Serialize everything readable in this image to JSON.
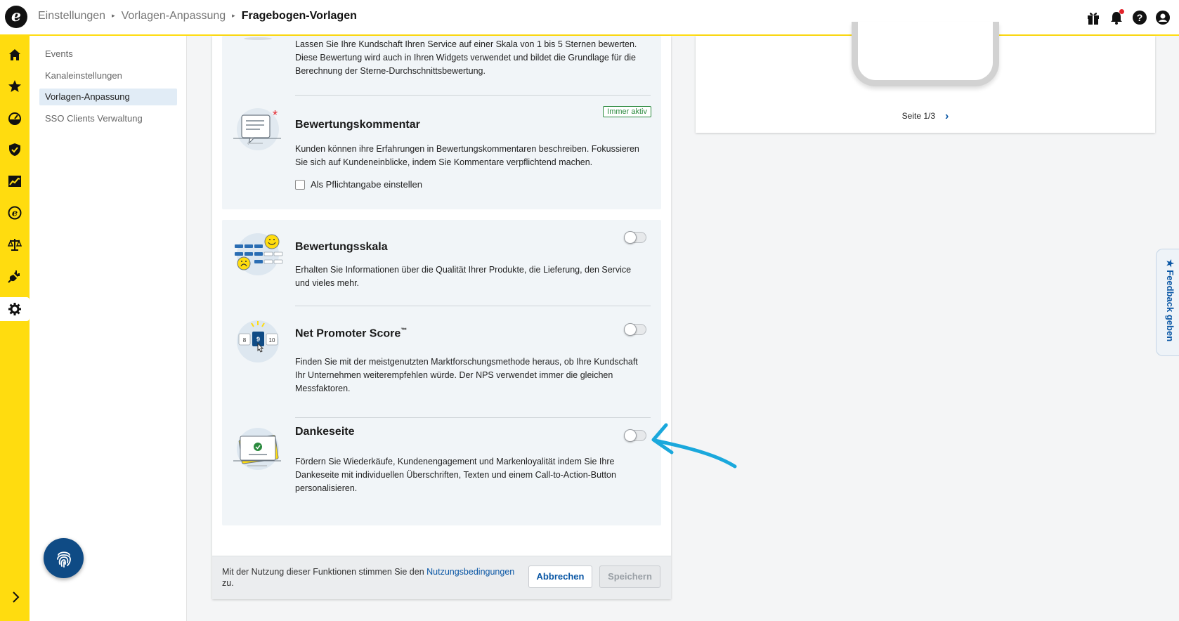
{
  "header": {
    "logo_text": "e",
    "breadcrumb": [
      "Einstellungen",
      "Vorlagen-Anpassung",
      "Fragebogen-Vorlagen"
    ],
    "separator": "▸",
    "icons": [
      "gift-icon",
      "bell-icon",
      "help-icon",
      "user-icon"
    ]
  },
  "rail": {
    "items": [
      "home-icon",
      "star-icon",
      "dashboard-icon",
      "shield-icon",
      "chart-icon",
      "trusted-e-icon",
      "scale-icon",
      "plug-icon",
      "gear-icon"
    ],
    "active": "gear-icon"
  },
  "subnav": {
    "items": [
      {
        "label": "Events"
      },
      {
        "label": "Kanaleinstellungen"
      },
      {
        "label": "Vorlagen-Anpassung",
        "active": true
      },
      {
        "label": "SSO Clients Verwaltung"
      }
    ]
  },
  "main": {
    "star_rating_desc": "Lassen Sie Ihre Kundschaft Ihren Service auf einer Skala von 1 bis 5 Sternen bewerten. Diese Bewertung wird auch in Ihren Widgets verwendet und bildet die Grundlage für die Berechnung der Sterne-Durchschnittsbewertung.",
    "comment": {
      "title": "Bewertungskommentar",
      "badge": "Immer aktiv",
      "desc": "Kunden können ihre Erfahrungen in Bewertungskommentaren beschreiben. Fokussieren Sie sich auf Kundeneinblicke, indem Sie Kommentare verpflichtend machen.",
      "checkbox_label": "Als Pflichtangabe einstellen",
      "checkbox_checked": false
    },
    "scale": {
      "title": "Bewertungsskala",
      "desc": "Erhalten Sie Informationen über die Qualität Ihrer Produkte, die Lieferung, den Service und vieles mehr.",
      "enabled": false
    },
    "nps": {
      "title": "Net Promoter Score",
      "tm": "™",
      "desc": "Finden Sie mit der meistgenutzten Marktforschungsmethode heraus, ob Ihre Kundschaft Ihr Unternehmen weiterempfehlen würde. Der NPS verwendet immer die gleichen Messfaktoren.",
      "enabled": false,
      "illus_numbers": [
        "8",
        "9",
        "10"
      ]
    },
    "thanks": {
      "title": "Dankeseite",
      "desc": "Fördern Sie Wiederkäufe, Kundenengagement und Markenloyalität indem Sie Ihre Dankeseite mit individuellen Überschriften, Texten und einem Call-to-Action-Button personalisieren.",
      "enabled": false
    },
    "footer": {
      "terms_prefix": "Mit der Nutzung dieser Funktionen stimmen Sie den ",
      "terms_link": "Nutzungsbedingungen",
      "terms_suffix": " zu.",
      "cancel_label": "Abbrechen",
      "save_label": "Speichern"
    }
  },
  "preview": {
    "pager_label": "Seite 1/3"
  },
  "feedback_tab": {
    "label": "★ Feedback geben"
  },
  "colors": {
    "rail": "#ffdc0f",
    "primary": "#0a57a5",
    "fab": "#0f4b85",
    "badge": "#2b8a3e",
    "arrow": "#1aa8dc"
  }
}
